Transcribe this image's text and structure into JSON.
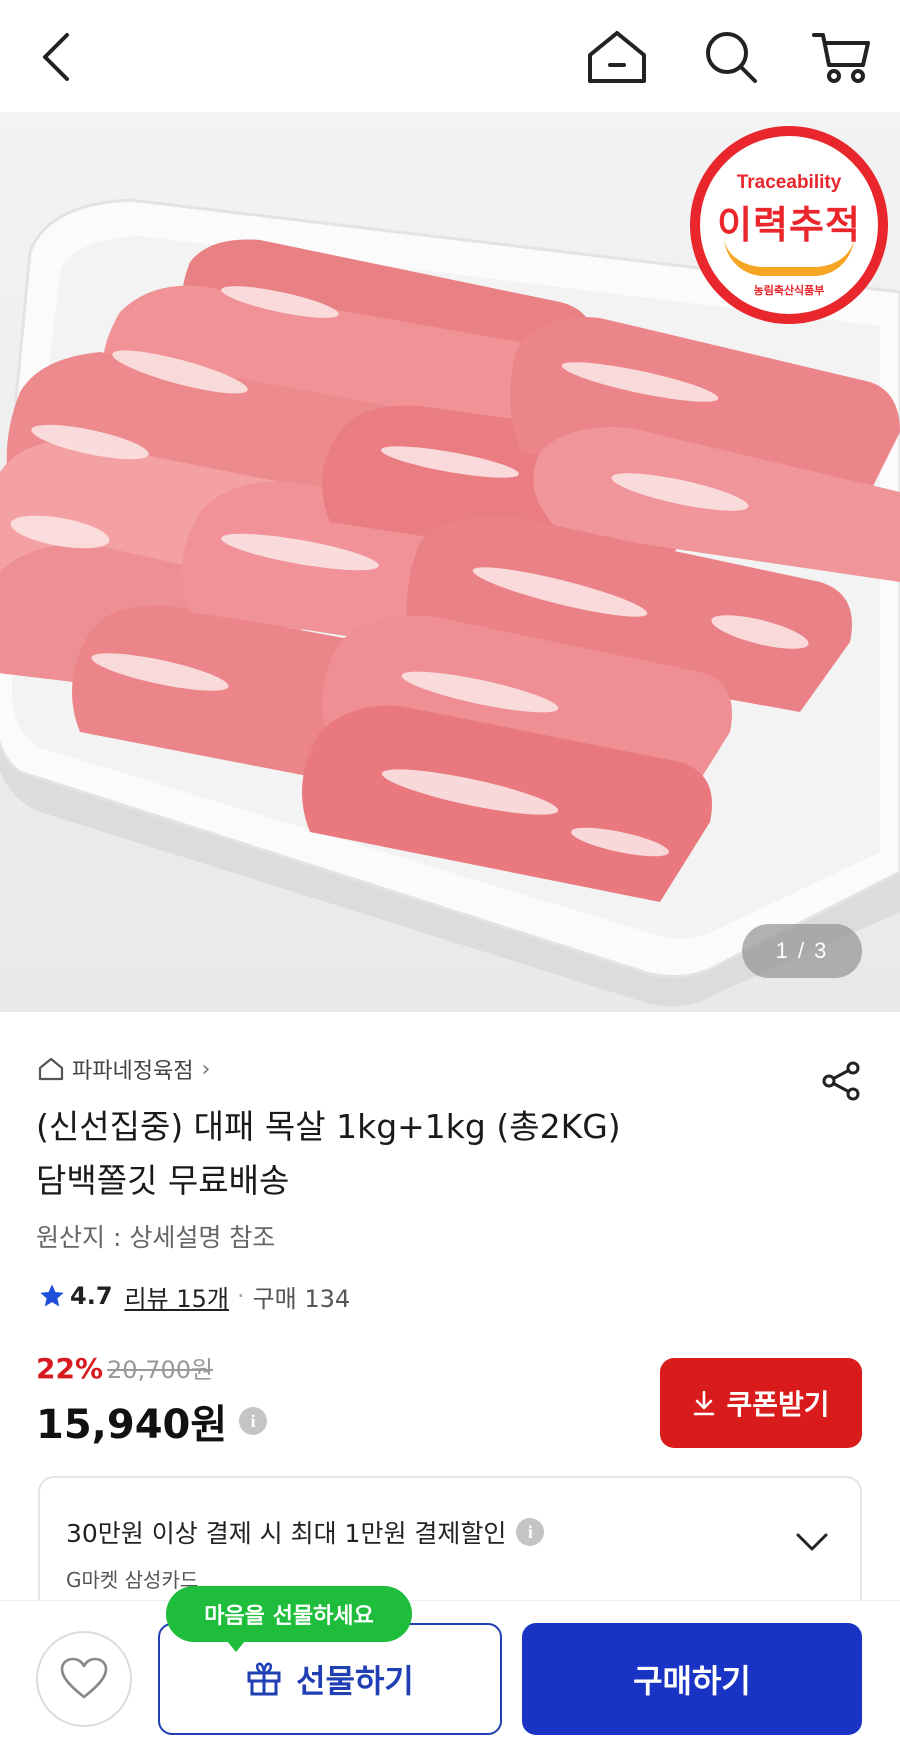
{
  "header": {
    "back_icon": "chevron-left-icon",
    "home_icon": "home-icon",
    "search_icon": "search-icon",
    "cart_icon": "cart-icon"
  },
  "gallery": {
    "badge": {
      "title_en": "Traceability",
      "title_ko": "이력추적",
      "issuer": "농림축산식품부"
    },
    "pager": "1 / 3"
  },
  "product": {
    "seller": "파파네정육점",
    "title_line1": "(신선집중) 대패 목살 1kg+1kg (총2KG)",
    "title_line2": "담백쫄깃 무료배송",
    "origin": "원산지 : 상세설명 참조",
    "rating": "4.7",
    "reviews": "리뷰 15개",
    "purchases": "구매 134",
    "discount_rate": "22%",
    "original_price": "20,700원",
    "sale_price": "15,940원"
  },
  "coupon": {
    "label": "쿠폰받기"
  },
  "promo": {
    "text": "30만원 이상 결제 시 최대 1만원 결제할인",
    "card": "G마켓 삼성카드"
  },
  "bottom": {
    "tooltip": "마음을 선물하세요",
    "gift_label": "선물하기",
    "buy_label": "구매하기"
  },
  "colors": {
    "accent_red": "#d91b1b",
    "primary_blue": "#1934c4",
    "tooltip_green": "#1ebd3b",
    "badge_red": "#e8262c"
  }
}
